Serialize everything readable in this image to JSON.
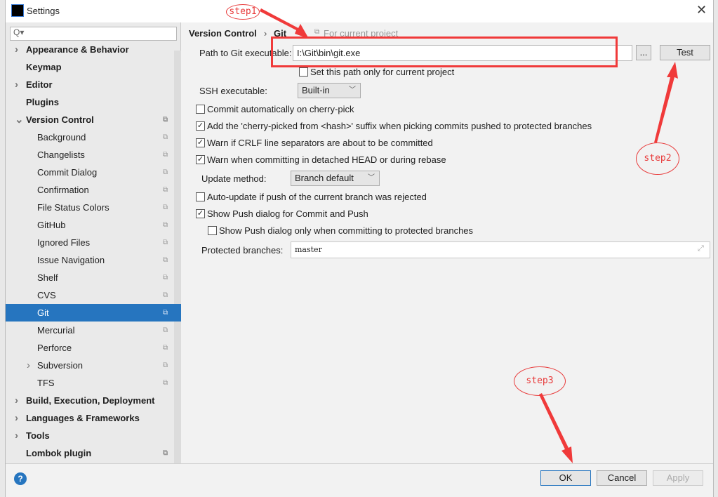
{
  "window": {
    "title": "Settings",
    "logo": "IJ",
    "close": "✕"
  },
  "search": {
    "placeholder": "Q▾"
  },
  "sidebar": {
    "items": [
      {
        "label": "Appearance & Behavior",
        "top": true,
        "arrow": true
      },
      {
        "label": "Keymap",
        "top": true
      },
      {
        "label": "Editor",
        "top": true,
        "arrow": true
      },
      {
        "label": "Plugins",
        "top": true
      },
      {
        "label": "Version Control",
        "top": true,
        "arrow": true,
        "open": true,
        "copy": true
      },
      {
        "label": "Background",
        "copy": true
      },
      {
        "label": "Changelists",
        "copy": true
      },
      {
        "label": "Commit Dialog",
        "copy": true
      },
      {
        "label": "Confirmation",
        "copy": true
      },
      {
        "label": "File Status Colors",
        "copy": true
      },
      {
        "label": "GitHub",
        "copy": true
      },
      {
        "label": "Ignored Files",
        "copy": true
      },
      {
        "label": "Issue Navigation",
        "copy": true
      },
      {
        "label": "Shelf",
        "copy": true
      },
      {
        "label": "CVS",
        "copy": true
      },
      {
        "label": "Git",
        "copy": true,
        "selected": true
      },
      {
        "label": "Mercurial",
        "copy": true
      },
      {
        "label": "Perforce",
        "copy": true
      },
      {
        "label": "Subversion",
        "copy": true,
        "arrow": true
      },
      {
        "label": "TFS",
        "copy": true
      },
      {
        "label": "Build, Execution, Deployment",
        "top": true,
        "arrow": true
      },
      {
        "label": "Languages & Frameworks",
        "top": true,
        "arrow": true
      },
      {
        "label": "Tools",
        "top": true,
        "arrow": true
      },
      {
        "label": "Lombok plugin",
        "top": true,
        "copy": true
      }
    ]
  },
  "breadcrumb": {
    "parent": "Version Control",
    "sep": "›",
    "current": "Git",
    "scope": "For current project"
  },
  "git": {
    "path_label": "Path to Git executable:",
    "path_value": "I:\\Git\\bin\\git.exe",
    "browse": "...",
    "test": "Test",
    "path_only_project": {
      "label": "Set this path only for current project",
      "checked": false
    },
    "ssh_label": "SSH executable:",
    "ssh_value": "Built-in",
    "options": [
      {
        "label": "Commit automatically on cherry-pick",
        "checked": false
      },
      {
        "label": "Add the 'cherry-picked from <hash>' suffix when picking commits pushed to protected branches",
        "checked": true
      },
      {
        "label": "Warn if CRLF line separators are about to be committed",
        "checked": true
      },
      {
        "label": "Warn when committing in detached HEAD or during rebase",
        "checked": true
      }
    ],
    "update_label": "Update method:",
    "update_value": "Branch default",
    "options2": [
      {
        "label": "Auto-update if push of the current branch was rejected",
        "checked": false
      },
      {
        "label": "Show Push dialog for Commit and Push",
        "checked": true
      },
      {
        "label": "Show Push dialog only when committing to protected branches",
        "checked": false
      }
    ],
    "protected_label": "Protected branches:",
    "protected_value": "master"
  },
  "footer": {
    "help": "?",
    "ok": "OK",
    "cancel": "Cancel",
    "apply": "Apply"
  },
  "annotations": {
    "step1": "step1",
    "step2": "step2",
    "step3": "step3"
  },
  "colors": {
    "accent": "#2675bf",
    "annotation": "#e83a3a"
  }
}
